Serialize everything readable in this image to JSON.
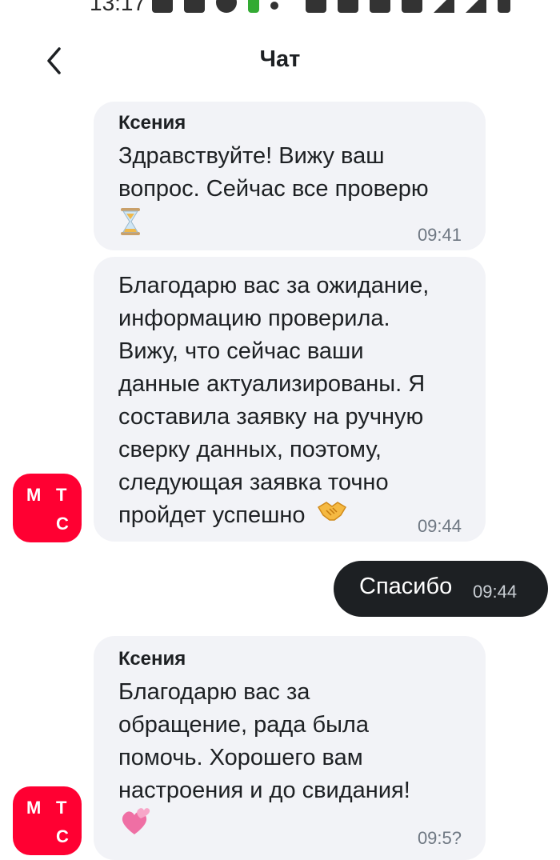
{
  "status_bar": {
    "time": "13:17"
  },
  "header": {
    "title": "Чат",
    "back_icon": "chevron-left-icon"
  },
  "messages": [
    {
      "author": "Ксения",
      "text": "Здравствуйте! Вижу ваш\nвопрос. Сейчас все проверю",
      "emoji": "hourglass-icon",
      "time": "09:41"
    },
    {
      "author": "",
      "text": "Благодарю вас за ожидание,\nинформацию проверила.\nВижу, что сейчас ваши\nданные актуализированы. Я\nсоставила заявку на ручную\nсверку данных, поэтому,\nследующая заявка точно\nпройдет успешно",
      "emoji": "handshake-icon",
      "time": "09:44"
    },
    {
      "outgoing": true,
      "text": "Спасибо",
      "time": "09:44"
    },
    {
      "author": "Ксения",
      "text": "Благодарю вас за\nобращение, рада была\nпомочь. Хорошего вам\nнастроения и до свидания!",
      "emoji": "hearts-icon",
      "time": "09:5?"
    }
  ],
  "avatar": {
    "letters": [
      "М",
      "Т",
      "С"
    ],
    "color": "#ff0032"
  },
  "colors": {
    "bubble_in": "#f2f3f7",
    "bubble_out": "#1d2023",
    "brand": "#ff0032"
  }
}
